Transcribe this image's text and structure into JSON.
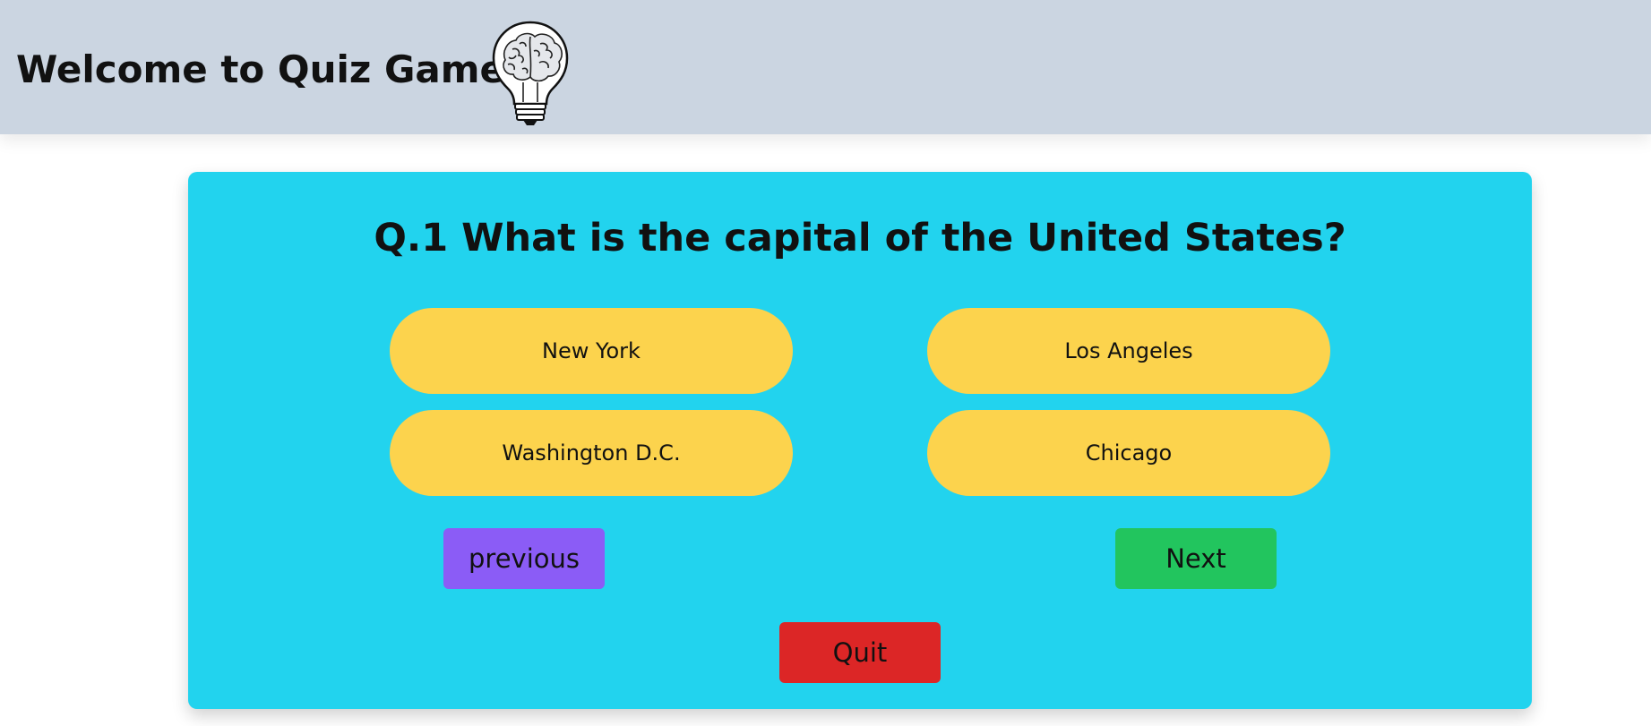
{
  "header": {
    "title": "Welcome to Quiz Game",
    "logo_icon": "brain-lightbulb-icon"
  },
  "quiz": {
    "question": "Q.1 What is the capital of the United States?",
    "options": [
      "New York",
      "Los Angeles",
      "Washington D.C.",
      "Chicago"
    ],
    "previous_label": "previous",
    "next_label": "Next",
    "quit_label": "Quit"
  },
  "colors": {
    "header_bg": "#cbd5e1",
    "card_bg": "#22d3ee",
    "option_bg": "#fcd34d",
    "previous_bg": "#8b5cf6",
    "next_bg": "#22c55e",
    "quit_bg": "#dc2626"
  }
}
